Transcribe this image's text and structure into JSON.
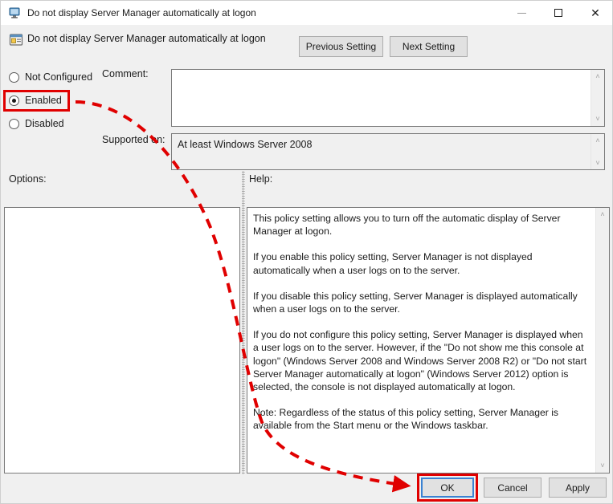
{
  "window": {
    "title": "Do not display Server Manager automatically at logon",
    "title_icon": "server-manager-monitor-icon",
    "minimize_label": "–",
    "maximize_label": "□",
    "close_label": "✕"
  },
  "header": {
    "policy_icon": "group-policy-setting-icon",
    "policy_title": "Do not display Server Manager automatically at logon",
    "previous_setting": "Previous Setting",
    "next_setting": "Next Setting"
  },
  "state": {
    "options": [
      {
        "label": "Not Configured",
        "selected": false
      },
      {
        "label": "Enabled",
        "selected": true
      },
      {
        "label": "Disabled",
        "selected": false
      }
    ]
  },
  "comment": {
    "label": "Comment:",
    "value": "",
    "scroll_up": "˄",
    "scroll_down": "˅"
  },
  "supported_on": {
    "label": "Supported on:",
    "value": "At least Windows Server 2008",
    "scroll_up": "˄",
    "scroll_down": "˅"
  },
  "options_panel": {
    "label": "Options:",
    "content": ""
  },
  "help_panel": {
    "label": "Help:",
    "scroll_up": "˄",
    "scroll_down": "˅",
    "paragraphs": [
      "This policy setting allows you to turn off the automatic display of Server Manager at logon.",
      "If you enable this policy setting, Server Manager is not displayed automatically when a user logs on to the server.",
      "If you disable this policy setting, Server Manager is displayed automatically when a user logs on to the server.",
      "If you do not configure this policy setting, Server Manager is displayed when a user logs on to the server. However, if the \"Do not show me this console at logon\" (Windows Server 2008 and Windows Server 2008 R2) or \"Do not start Server Manager automatically at logon\" (Windows Server 2012) option is selected, the console is not displayed automatically at logon.",
      "Note: Regardless of the status of this policy setting, Server Manager is available from the Start menu or the Windows taskbar."
    ]
  },
  "footer": {
    "ok": "OK",
    "cancel": "Cancel",
    "apply": "Apply"
  },
  "annotation": {
    "highlight_color": "#e00000",
    "focus_color": "#3a82d2",
    "arrow_description": "dashed red arrow from Enabled radio to OK button"
  }
}
